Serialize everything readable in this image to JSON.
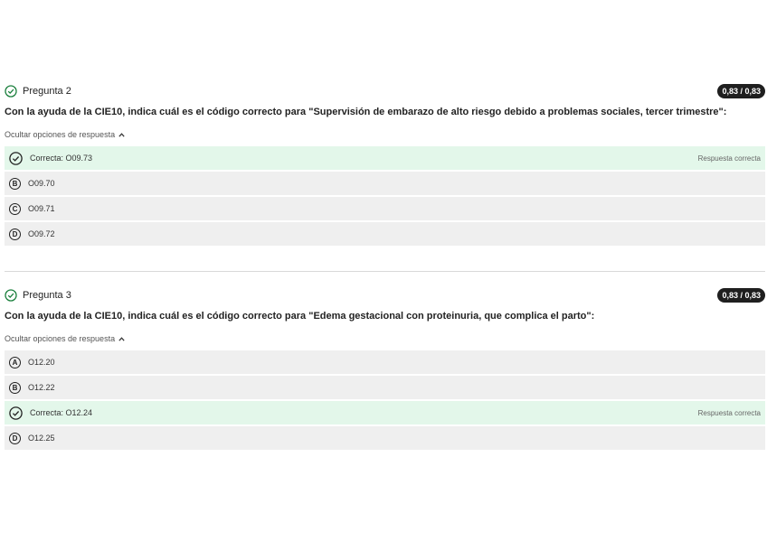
{
  "questions": [
    {
      "title": "Pregunta 2",
      "score": "0,83 / 0,83",
      "text": "Con la ayuda de la CIE10, indica cuál es el código correcto para \"Supervisión de embarazo de alto riesgo debido a problemas sociales, tercer trimestre\":",
      "toggle_label": "Ocultar opciones de respuesta",
      "options": [
        {
          "label": "Correcta: O09.73",
          "status": "Respuesta correcta"
        },
        {
          "letter": "B",
          "label": "O09.70"
        },
        {
          "letter": "C",
          "label": "O09.71"
        },
        {
          "letter": "D",
          "label": "O09.72"
        }
      ]
    },
    {
      "title": "Pregunta 3",
      "score": "0,83 / 0,83",
      "text": "Con la ayuda de la CIE10, indica cuál es el código correcto para \"Edema gestacional con proteinuria, que complica el parto\":",
      "toggle_label": "Ocultar opciones de respuesta",
      "options": [
        {
          "letter": "A",
          "label": "O12.20"
        },
        {
          "letter": "B",
          "label": "O12.22"
        },
        {
          "label": "Correcta: O12.24",
          "status": "Respuesta correcta"
        },
        {
          "letter": "D",
          "label": "O12.25"
        }
      ]
    }
  ],
  "icons": {
    "check": "check-circle-icon",
    "collapse": "chevron-up-icon"
  },
  "colors": {
    "correct_bg": "#e3f7ea",
    "option_bg": "#efefef",
    "check_green": "#1a7f3c",
    "badge_bg": "#1f1f1f"
  }
}
